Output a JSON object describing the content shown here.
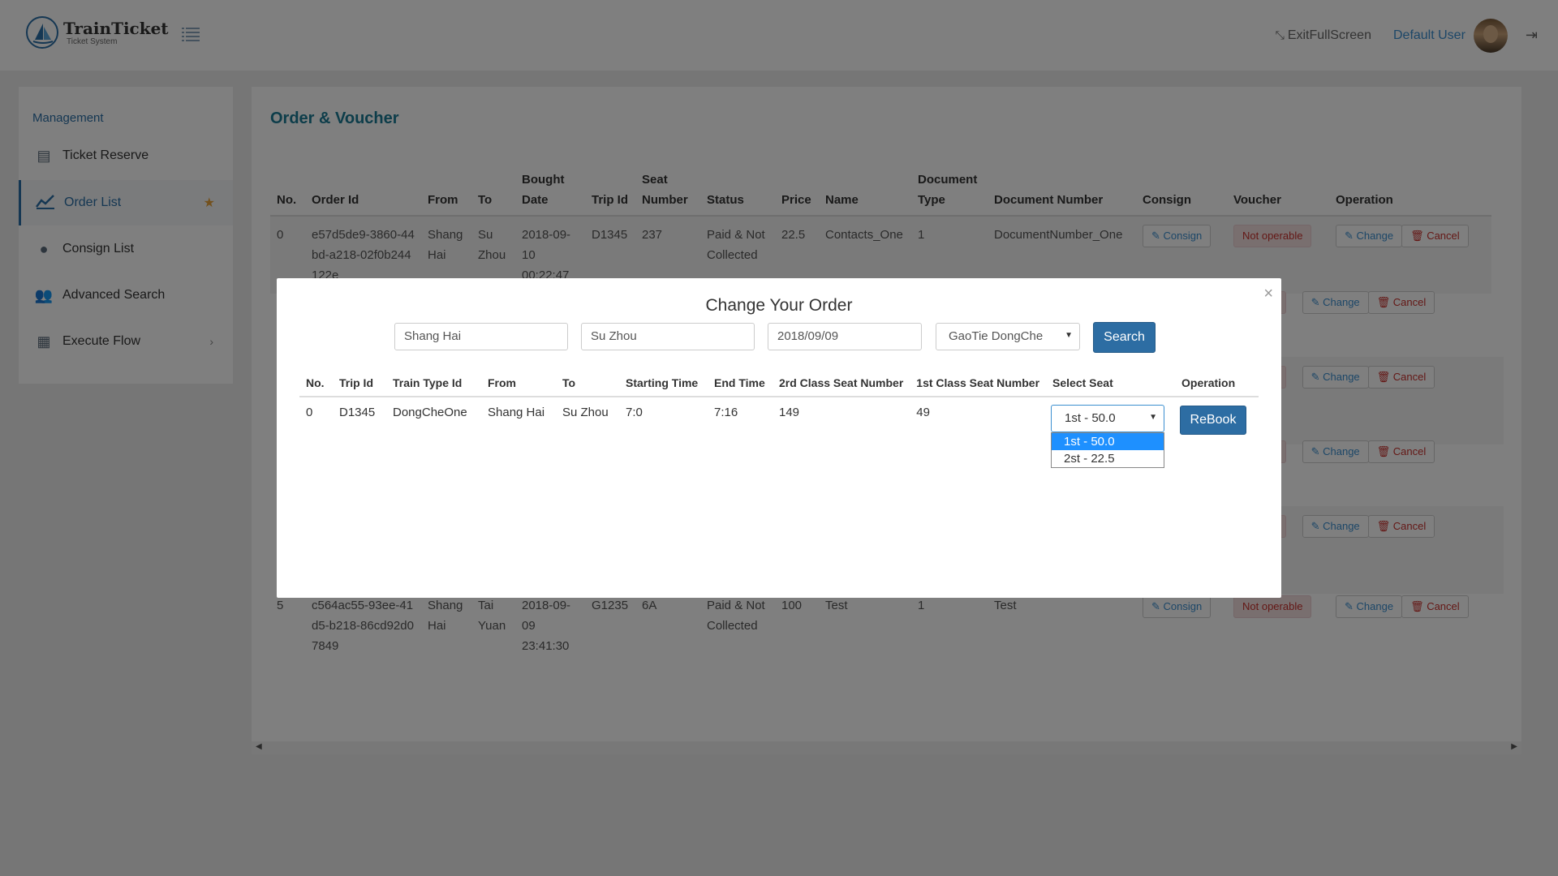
{
  "header": {
    "app_title": "TrainTicket",
    "app_subtitle": "Ticket System",
    "exit_fullscreen": "ExitFullScreen",
    "username": "Default User"
  },
  "sidebar": {
    "heading": "Management",
    "items": [
      {
        "label": "Ticket Reserve",
        "icon": "list-icon"
      },
      {
        "label": "Order List",
        "icon": "chart-line-icon",
        "active": true
      },
      {
        "label": "Consign List",
        "icon": "globe-icon"
      },
      {
        "label": "Advanced Search",
        "icon": "users-icon"
      },
      {
        "label": "Execute Flow",
        "icon": "table-icon"
      }
    ]
  },
  "main": {
    "title": "Order & Voucher",
    "columns": [
      "No.",
      "Order Id",
      "From",
      "To",
      "Bought Date",
      "Trip Id",
      "Seat Number",
      "Status",
      "Price",
      "Name",
      "Document Type",
      "Document Number",
      "Consign",
      "Voucher",
      "Operation"
    ],
    "rows": [
      {
        "no": "0",
        "order_id": "e57d5de9-3860-44bd-a218-02f0b244122e",
        "from": "Shang Hai",
        "to": "Su Zhou",
        "bought": "2018-09-10 00:22:47",
        "trip": "D1345",
        "seat": "237",
        "status": "Paid & Not Collected",
        "price": "22.5",
        "name": "Contacts_One",
        "doc_type": "1",
        "doc_num": "DocumentNumber_One"
      },
      {
        "no": "5",
        "order_id": "c564ac55-93ee-41d5-b218-86cd92d07849",
        "from": "Shang Hai",
        "to": "Tai Yuan",
        "bought": "2018-09-09 23:41:30",
        "trip": "G1235",
        "seat": "6A",
        "status": "Paid & Not Collected",
        "price": "100",
        "name": "Test",
        "doc_type": "1",
        "doc_num": "Test"
      }
    ],
    "btn_consign": "Consign",
    "btn_not_operable": "Not operable",
    "btn_not_operable_partial": "erable",
    "btn_change": "Change",
    "btn_cancel": "Cancel"
  },
  "modal": {
    "title": "Change Your Order",
    "from_value": "Shang Hai",
    "to_value": "Su Zhou",
    "date_value": "2018/09/09",
    "train_type_value": "GaoTie DongChe",
    "search_label": "Search",
    "columns": [
      "No.",
      "Trip Id",
      "Train Type Id",
      "From",
      "To",
      "Starting Time",
      "End Time",
      "2rd Class Seat Number",
      "1st Class Seat Number",
      "Select Seat",
      "Operation"
    ],
    "row": {
      "no": "0",
      "trip": "D1345",
      "train_type": "DongCheOne",
      "from": "Shang Hai",
      "to": "Su Zhou",
      "start": "7:0",
      "end": "7:16",
      "second_class": "149",
      "first_class": "49"
    },
    "seat_selected": "1st - 50.0",
    "seat_options": [
      "1st - 50.0",
      "2st - 22.5"
    ],
    "rebook_label": "ReBook"
  }
}
